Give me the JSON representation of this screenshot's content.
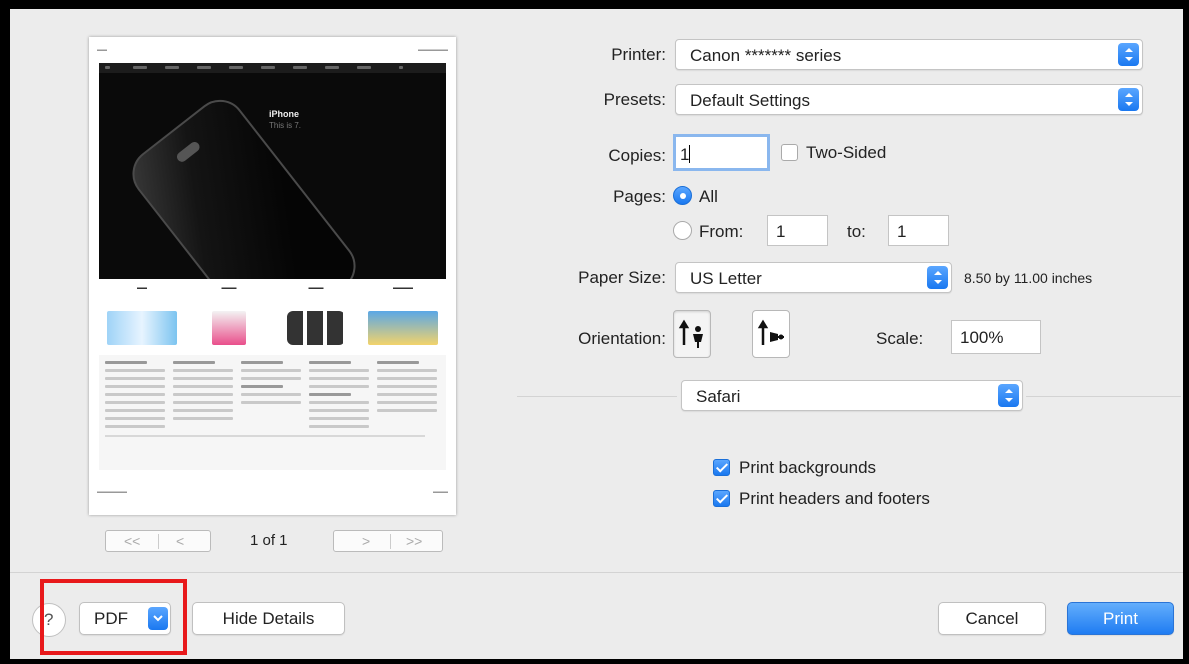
{
  "preview": {
    "hero_title": "iPhone",
    "hero_subtitle": "This is 7.",
    "page_indicator": "1 of 1",
    "first_page_glyph": "<<",
    "prev_page_glyph": "<",
    "next_page_glyph": ">",
    "last_page_glyph": ">>"
  },
  "printer": {
    "label": "Printer:",
    "value": "Canon  *******  series"
  },
  "presets": {
    "label": "Presets:",
    "value": "Default Settings"
  },
  "copies": {
    "label": "Copies:",
    "value": "1",
    "two_sided_label": "Two-Sided",
    "two_sided_checked": false
  },
  "pages": {
    "label": "Pages:",
    "all_label": "All",
    "from_label": "From:",
    "from_value": "1",
    "to_label": "to:",
    "to_value": "1",
    "selected": "all"
  },
  "paper_size": {
    "label": "Paper Size:",
    "value": "US Letter",
    "dimensions": "8.50 by 11.00 inches"
  },
  "orientation": {
    "label": "Orientation:",
    "selected": "portrait"
  },
  "scale": {
    "label": "Scale:",
    "value": "100%"
  },
  "app_section": {
    "value": "Safari"
  },
  "options": [
    {
      "label": "Print backgrounds",
      "checked": true
    },
    {
      "label": "Print headers and footers",
      "checked": true
    }
  ],
  "bottom": {
    "pdf_label": "PDF",
    "hide_details_label": "Hide Details",
    "cancel_label": "Cancel",
    "print_label": "Print"
  },
  "colors": {
    "accent": "#1f7cf2",
    "highlight": "#e8191b"
  }
}
